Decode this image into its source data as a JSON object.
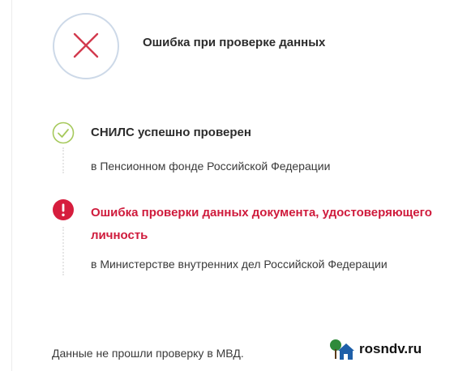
{
  "header": {
    "title": "Ошибка при проверке данных",
    "status_icon": "error-x-icon"
  },
  "checks": [
    {
      "status": "success",
      "icon": "check-circle-icon",
      "title": "СНИЛС успешно проверен",
      "subtitle": "в Пенсионном фонде Российской Федерации"
    },
    {
      "status": "error",
      "icon": "exclamation-circle-icon",
      "title": "Ошибка проверки данных документа, удостоверяющего личность",
      "subtitle": "в Министерстве внутренних дел Российской Федерации"
    }
  ],
  "footer": {
    "message": "Данные не прошли проверку в МВД."
  },
  "watermark": {
    "text": "rosndv.ru",
    "icon": "house-tree-icon"
  },
  "colors": {
    "error_red": "#cf1b3c",
    "success_green": "#a6c95c",
    "circle_border": "#cdd9e8",
    "x_mark": "#d23a4e"
  }
}
